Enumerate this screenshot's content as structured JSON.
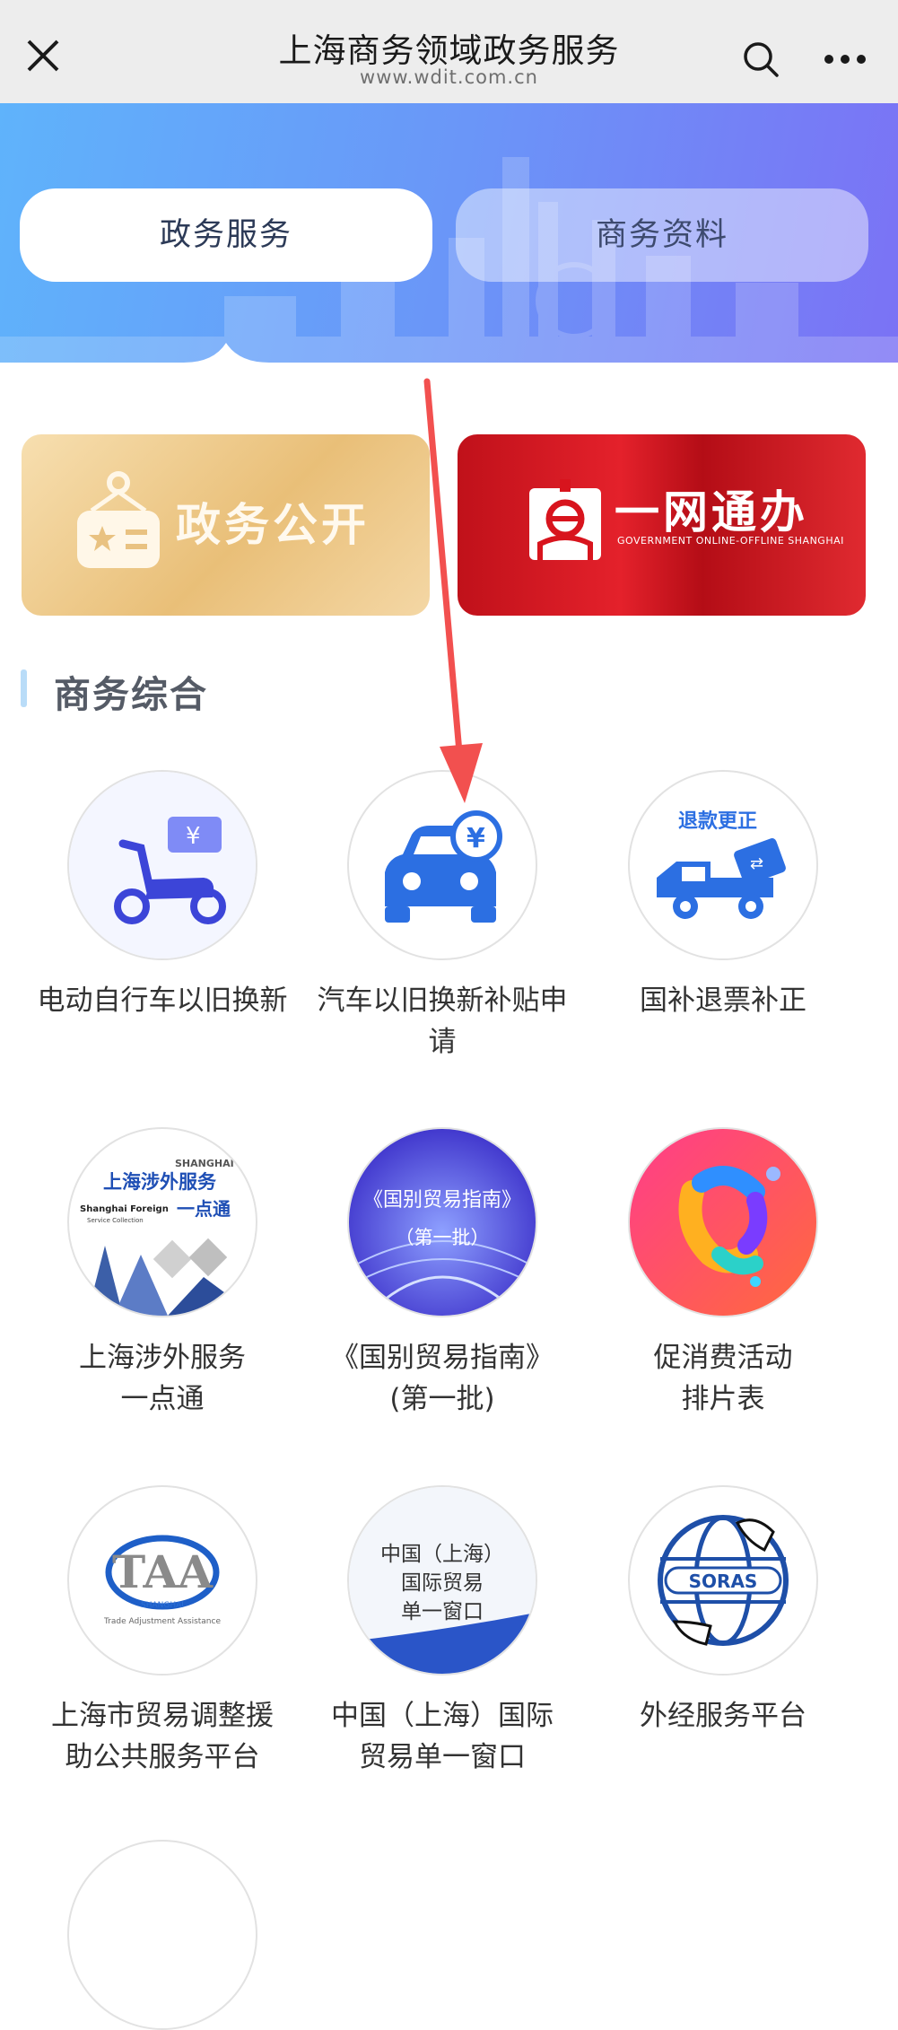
{
  "header": {
    "title": "上海商务领域政务服务",
    "url": "www.wdit.com.cn"
  },
  "tabs": [
    {
      "label": "政务服务",
      "active": true
    },
    {
      "label": "商务资料",
      "active": false
    }
  ],
  "cards": {
    "gov_open": {
      "label": "政务公开"
    },
    "one_net": {
      "label": "一网通办",
      "sublabel": "GOVERNMENT ONLINE-OFFLINE SHANGHAI"
    }
  },
  "section": {
    "title": "商务综合"
  },
  "items": [
    {
      "caption": "电动自行车以旧换新",
      "icon": "electric-scooter-icon"
    },
    {
      "caption": "汽车以旧换新补贴申请",
      "icon": "car-yuan-icon"
    },
    {
      "caption": "国补退票补正",
      "icon": "refund-truck-icon",
      "badge": "退款更正"
    },
    {
      "caption": "上海涉外服务一点通",
      "icon": "foreign-service-icon",
      "logo_text": {
        "top": "SHANGHAI",
        "cn": "上海涉外服务",
        "cn2": "一点通",
        "en": "Shanghai Foreign",
        "en2": "Service Collection"
      }
    },
    {
      "caption": "《国别贸易指南》(第一批)",
      "icon": "trade-guide-icon",
      "logo_text": {
        "line1": "《国别贸易指南》",
        "line2": "（第一批）"
      }
    },
    {
      "caption": "促消费活动排片表",
      "icon": "consumption-logo-icon"
    },
    {
      "caption": "上海市贸易调整援助公共服务平台",
      "icon": "taa-logo-icon",
      "logo_text": {
        "main": "TAA",
        "sub": "SHANGHAI",
        "en": "Trade Adjustment Assistance"
      }
    },
    {
      "caption": "中国（上海）国际贸易单一窗口",
      "icon": "single-window-icon",
      "logo_text": {
        "l1": "中国（上海）",
        "l2": "国际贸易",
        "l3": "单一窗口"
      }
    },
    {
      "caption": "外经服务平台",
      "icon": "soras-logo-icon",
      "logo_text": {
        "main": "SORAS"
      }
    }
  ],
  "captions_split": {
    "item0": [
      "电动自行车以旧换新"
    ],
    "item1": [
      "汽车以旧换新补贴申",
      "请"
    ],
    "item2": [
      "国补退票补正"
    ],
    "item3": [
      "上海涉外服务",
      "一点通"
    ],
    "item4": [
      "《国别贸易指南》",
      "(第一批)"
    ],
    "item5": [
      "促消费活动",
      "排片表"
    ],
    "item6": [
      "上海市贸易调整援",
      "助公共服务平台"
    ],
    "item7": [
      "中国（上海）国际",
      "贸易单一窗口"
    ],
    "item8": [
      "外经服务平台"
    ]
  },
  "colors": {
    "accent": "#3f6fe0",
    "banner_start": "#5fb3fb",
    "banner_end": "#7b72f5",
    "annotation_arrow": "#f2504f"
  }
}
